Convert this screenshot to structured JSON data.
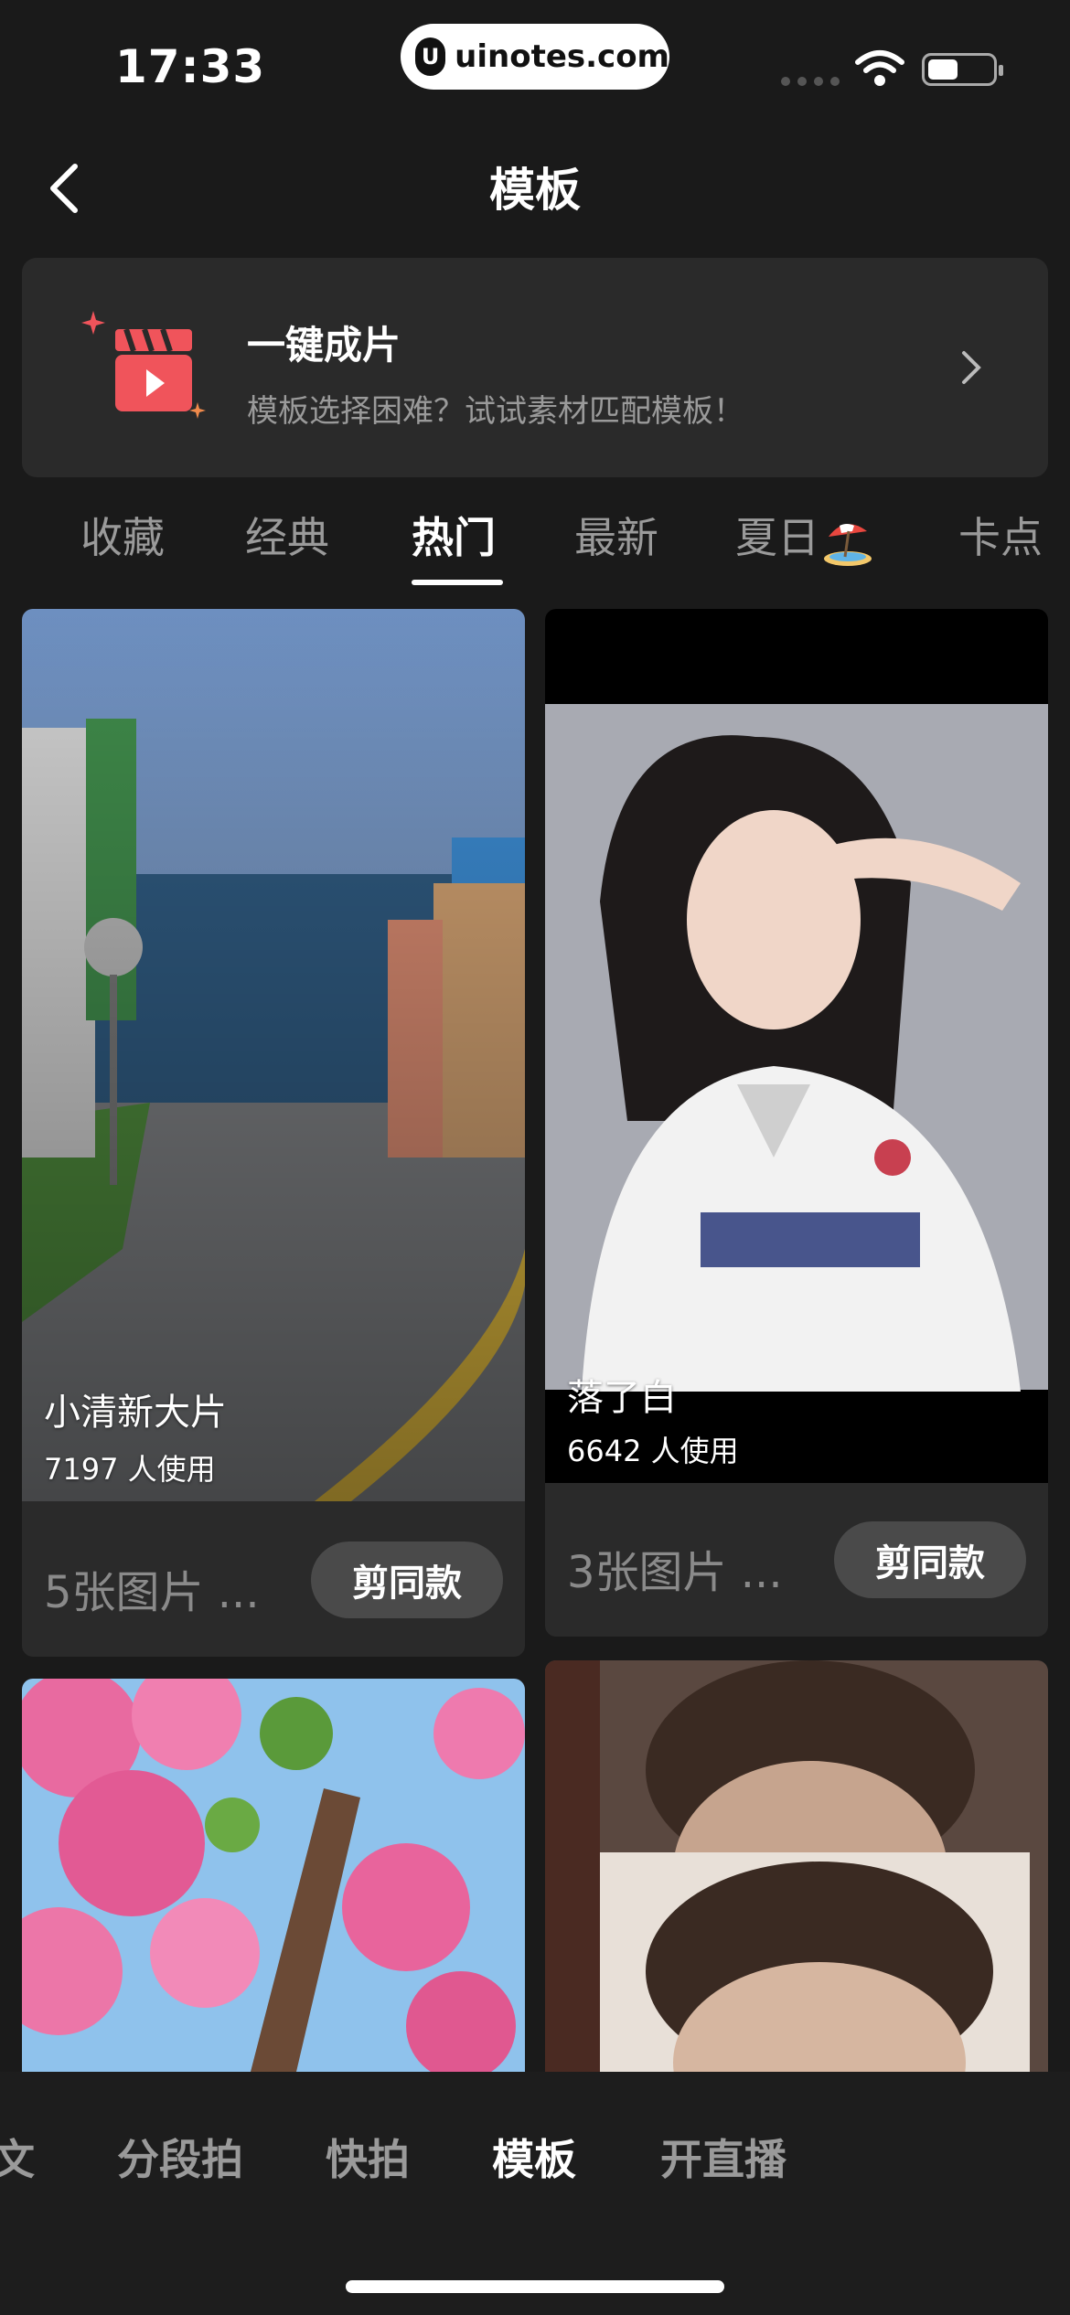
{
  "status_bar": {
    "time": "17:33",
    "url": "uinotes.com",
    "url_logo": "U"
  },
  "header": {
    "title": "模板"
  },
  "banner": {
    "title": "一键成片",
    "subtitle": "模板选择困难？试试素材匹配模板！"
  },
  "tabs": [
    {
      "label": "收藏"
    },
    {
      "label": "经典"
    },
    {
      "label": "热门"
    },
    {
      "label": "最新"
    },
    {
      "label": "夏日"
    },
    {
      "label": "卡点"
    }
  ],
  "active_tab": "热门",
  "cards": [
    {
      "name": "小清新大片",
      "usage": "7197 人使用",
      "count": "5张图片 ...",
      "button": "剪同款"
    },
    {
      "name": "落了白",
      "usage": "6642 人使用",
      "count": "3张图片 ...",
      "button": "剪同款"
    }
  ],
  "bottom_nav": [
    {
      "label": "文"
    },
    {
      "label": "分段拍"
    },
    {
      "label": "快拍"
    },
    {
      "label": "模板"
    },
    {
      "label": "开直播"
    }
  ],
  "active_nav": "模板",
  "colors": {
    "background": "#1a1a1a",
    "surface": "#2a2a2a",
    "accent": "#f0545b"
  }
}
